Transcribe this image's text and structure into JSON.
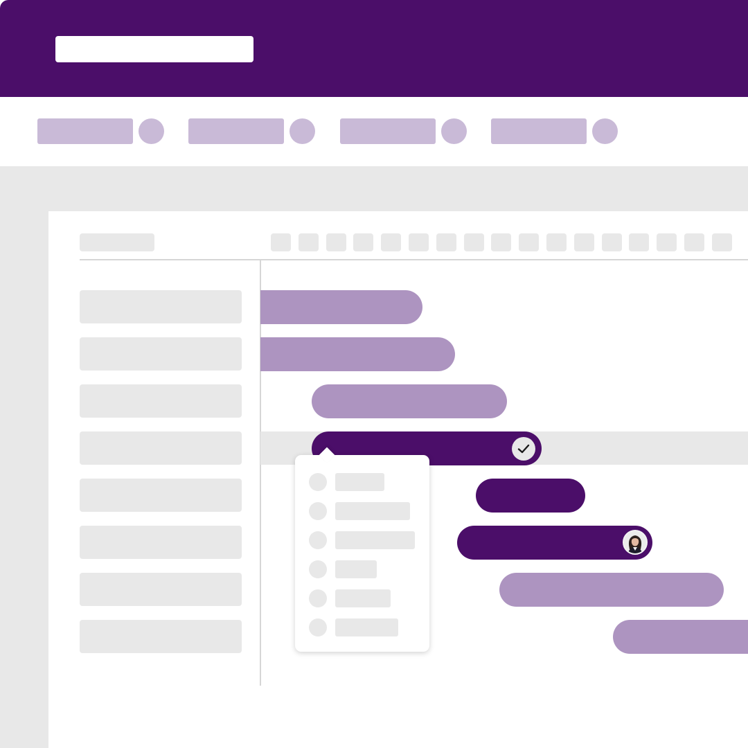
{
  "app": {
    "accent": "#4b0e69",
    "accent_light": "#ad94c0",
    "placeholder": "#e8e8e8",
    "nav_placeholder": "#c9bad7"
  },
  "header": {
    "title": ""
  },
  "nav": {
    "tabs": [
      {
        "label": ""
      },
      {
        "label": ""
      },
      {
        "label": ""
      },
      {
        "label": ""
      }
    ]
  },
  "timeline": {
    "columns": 17,
    "tasks": 8
  },
  "tasks": [
    {
      "style": "light"
    },
    {
      "style": "light"
    },
    {
      "style": "light"
    },
    {
      "style": "dark",
      "status_icon": "check-icon",
      "selected": true
    },
    {
      "style": "dark"
    },
    {
      "style": "dark",
      "assignee_icon": "avatar"
    },
    {
      "style": "light"
    },
    {
      "style": "light"
    }
  ],
  "popover": {
    "items": 6,
    "item_icon": "circle-icon"
  }
}
